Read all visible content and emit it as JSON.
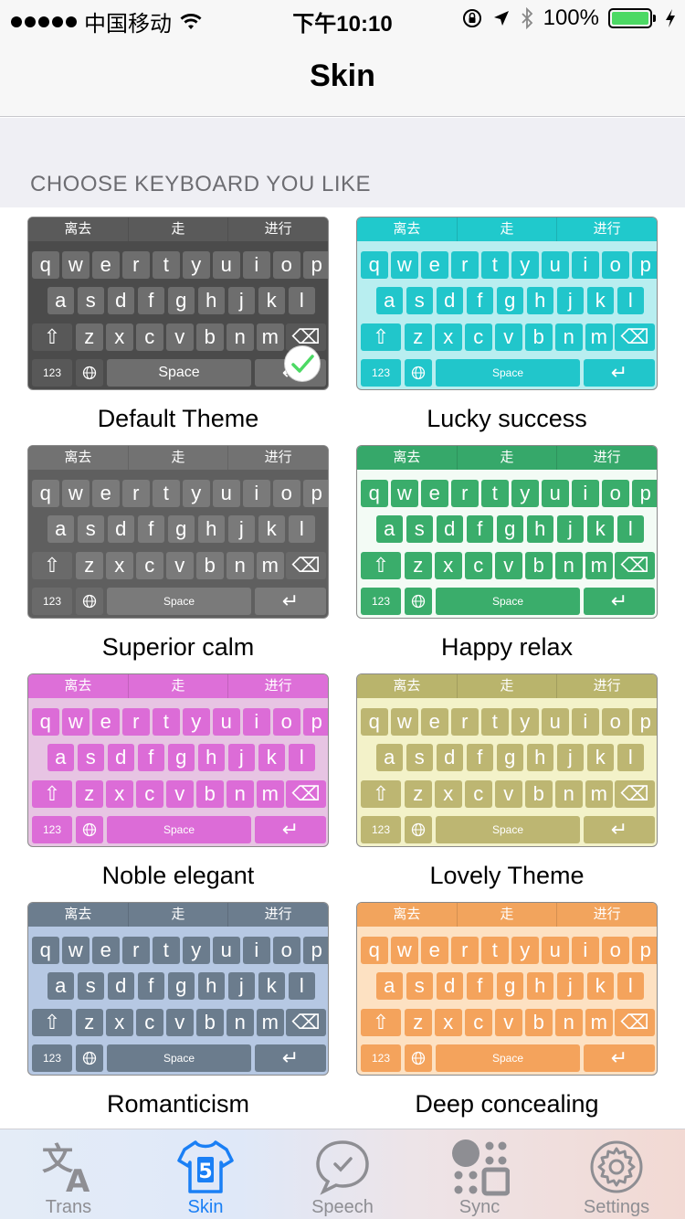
{
  "status_bar": {
    "carrier": "中国移动",
    "time": "下午10:10",
    "battery": "100%",
    "icons": [
      "signal-dots-icon",
      "wifi-icon",
      "orientation-lock-icon",
      "location-arrow-icon",
      "bluetooth-icon",
      "battery-icon",
      "charging-bolt-icon"
    ]
  },
  "nav": {
    "title": "Skin"
  },
  "section": {
    "title": "CHOOSE KEYBOARD YOU LIKE"
  },
  "keyboard_labels": {
    "top": [
      "离去",
      "走",
      "进行"
    ],
    "row1": [
      "q",
      "w",
      "e",
      "r",
      "t",
      "y",
      "u",
      "i",
      "o",
      "p"
    ],
    "row2": [
      "a",
      "s",
      "d",
      "f",
      "g",
      "h",
      "j",
      "k",
      "l"
    ],
    "row3": [
      "z",
      "x",
      "c",
      "v",
      "b",
      "n",
      "m"
    ],
    "shift": "⇧",
    "backspace": "⌫",
    "num": "123",
    "space": "Space",
    "return": "↵"
  },
  "themes": [
    {
      "name": "Default Theme",
      "selected": true,
      "colors": {
        "bg": "#4b4b4b",
        "top": "#5a5a5a",
        "key": "#6e6e6e",
        "fn": "#585858",
        "text": "#ffffff",
        "toptext": "#ffffff"
      }
    },
    {
      "name": "Lucky success",
      "selected": false,
      "colors": {
        "bg": "#b8eef0",
        "top": "#20c9cc",
        "key": "#21c6cb",
        "fn": "#21c6cb",
        "text": "#ffffff",
        "toptext": "#ffffff"
      }
    },
    {
      "name": "Superior calm",
      "selected": false,
      "colors": {
        "bg": "#5f5f5f",
        "top": "#727272",
        "key": "#7a7a7a",
        "fn": "#6a6a6a",
        "text": "#ffffff",
        "toptext": "#ffffff"
      }
    },
    {
      "name": "Happy relax",
      "selected": false,
      "colors": {
        "bg": "#f3fbf5",
        "top": "#36a86a",
        "key": "#3aad6b",
        "fn": "#3aad6b",
        "text": "#ffffff",
        "toptext": "#ffffff"
      }
    },
    {
      "name": "Noble elegant",
      "selected": false,
      "colors": {
        "bg": "#e7c4e3",
        "top": "#dd6fd8",
        "key": "#dc6cd7",
        "fn": "#dc6cd7",
        "text": "#ffffff",
        "toptext": "#ffffff"
      }
    },
    {
      "name": "Lovely Theme",
      "selected": false,
      "colors": {
        "bg": "#f3f2c9",
        "top": "#b9b46c",
        "key": "#bdb672",
        "fn": "#bdb672",
        "text": "#ffffff",
        "toptext": "#ffffff"
      }
    },
    {
      "name": "Romanticism",
      "selected": false,
      "colors": {
        "bg": "#b6c8e3",
        "top": "#6c7d8e",
        "key": "#6b7c8d",
        "fn": "#6b7c8d",
        "text": "#ffffff",
        "toptext": "#ffffff"
      }
    },
    {
      "name": "Deep concealing",
      "selected": false,
      "colors": {
        "bg": "#fde1c2",
        "top": "#f2a45d",
        "key": "#f4a35c",
        "fn": "#f4a35c",
        "text": "#ffffff",
        "toptext": "#ffffff"
      }
    }
  ],
  "tabs": [
    {
      "label": "Trans",
      "icon": "translate-icon",
      "active": false
    },
    {
      "label": "Skin",
      "icon": "shirt-icon",
      "active": true
    },
    {
      "label": "Speech",
      "icon": "speech-bubble-icon",
      "active": false
    },
    {
      "label": "Sync",
      "icon": "sync-dots-icon",
      "active": false
    },
    {
      "label": "Settings",
      "icon": "gear-icon",
      "active": false
    }
  ],
  "accent_color": "#1a7ff5"
}
